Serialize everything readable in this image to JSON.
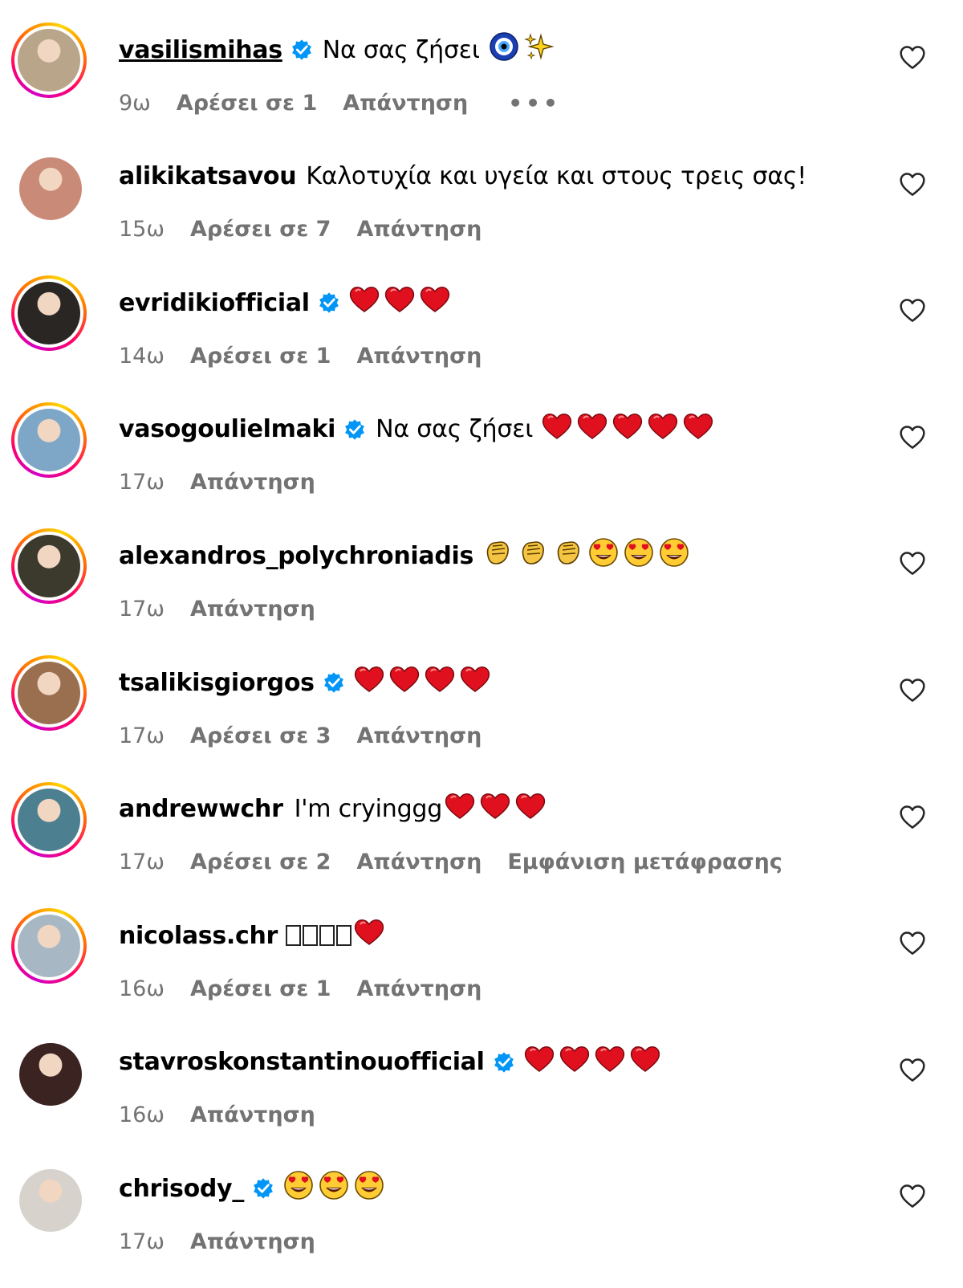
{
  "comments": [
    {
      "username": "vasilismihas",
      "verified": true,
      "underline": true,
      "text": "Να σας ζήσει",
      "emojis": [
        "nazar",
        "sparkles"
      ],
      "time": "9ω",
      "likes": "Αρέσει σε 1",
      "reply": "Απάντηση",
      "more": "•••",
      "story": true,
      "avatar": "#b9a58a"
    },
    {
      "username": "alikikatsavou",
      "verified": false,
      "text": "Καλοτυχία και υγεία και στους τρεις σας!",
      "emojis": [],
      "time": "15ω",
      "likes": "Αρέσει σε 7",
      "reply": "Απάντηση",
      "story": false,
      "avatar": "#c98a78"
    },
    {
      "username": "evridikiofficial",
      "verified": true,
      "text": "",
      "emojis": [
        "heart",
        "heart",
        "heart"
      ],
      "time": "14ω",
      "likes": "Αρέσει σε 1",
      "reply": "Απάντηση",
      "story": true,
      "avatar": "#2a2623"
    },
    {
      "username": "vasogoulielmaki",
      "verified": true,
      "text": "Να σας ζήσει",
      "emojis": [
        "heart",
        "heart",
        "heart",
        "heart",
        "heart"
      ],
      "time": "17ω",
      "reply": "Απάντηση",
      "story": true,
      "avatar": "#7ea7c7"
    },
    {
      "username": "alexandros_polychroniadis",
      "verified": false,
      "text": "",
      "emojis": [
        "clap",
        "clap",
        "clap",
        "heart-eyes",
        "heart-eyes",
        "heart-eyes"
      ],
      "time": "17ω",
      "reply": "Απάντηση",
      "story": true,
      "avatar": "#3b3a2c"
    },
    {
      "username": "tsalikisgiorgos",
      "verified": true,
      "text": "",
      "emojis": [
        "heart",
        "heart",
        "heart",
        "heart"
      ],
      "time": "17ω",
      "likes": "Αρέσει σε 3",
      "reply": "Απάντηση",
      "story": true,
      "avatar": "#9a6f50"
    },
    {
      "username": "andrewwchr",
      "verified": false,
      "text": "I'm cryinggg",
      "emojis": [
        "heart",
        "heart",
        "heart"
      ],
      "time": "17ω",
      "likes": "Αρέσει σε 2",
      "reply": "Απάντηση",
      "translate": "Εμφάνιση μετάφρασης",
      "story": true,
      "avatar": "#4c7f8f"
    },
    {
      "username": "nicolass.chr",
      "verified": false,
      "text": "",
      "tofu": 4,
      "emojis": [
        "heart"
      ],
      "time": "16ω",
      "likes": "Αρέσει σε 1",
      "reply": "Απάντηση",
      "story": true,
      "avatar": "#a7b8c4"
    },
    {
      "username": "stavroskonstantinouofficial",
      "verified": true,
      "text": "",
      "emojis": [
        "heart",
        "heart",
        "heart",
        "heart"
      ],
      "time": "16ω",
      "reply": "Απάντηση",
      "story": false,
      "avatar": "#3a2320"
    },
    {
      "username": "chrisody_",
      "verified": true,
      "text": "",
      "emojis": [
        "heart-eyes",
        "heart-eyes",
        "heart-eyes"
      ],
      "time": "17ω",
      "reply": "Απάντηση",
      "story": false,
      "avatar": "#d7d2cc"
    }
  ],
  "colors": {
    "meta": "#737373",
    "verified": "#0095f6",
    "heart": "#e0101e"
  },
  "icons": {
    "like": "heart-outline-icon",
    "verified": "verified-badge-icon"
  }
}
